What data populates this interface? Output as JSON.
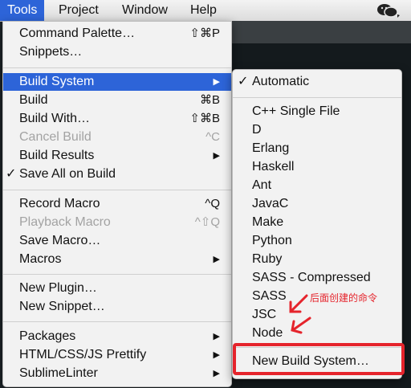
{
  "menubar": {
    "items": [
      "Tools",
      "Project",
      "Window",
      "Help"
    ],
    "active": "Tools"
  },
  "tools_menu": {
    "command_palette": {
      "label": "Command Palette…",
      "shortcut": "⇧⌘P"
    },
    "snippets": {
      "label": "Snippets…"
    },
    "build_system": {
      "label": "Build System"
    },
    "build": {
      "label": "Build",
      "shortcut": "⌘B"
    },
    "build_with": {
      "label": "Build With…",
      "shortcut": "⇧⌘B"
    },
    "cancel_build": {
      "label": "Cancel Build",
      "shortcut": "^C"
    },
    "build_results": {
      "label": "Build Results"
    },
    "save_all_on_build": {
      "label": "Save All on Build",
      "checked": true
    },
    "record_macro": {
      "label": "Record Macro",
      "shortcut": "^Q"
    },
    "playback_macro": {
      "label": "Playback Macro",
      "shortcut": "^⇧Q"
    },
    "save_macro": {
      "label": "Save Macro…"
    },
    "macros": {
      "label": "Macros"
    },
    "new_plugin": {
      "label": "New Plugin…"
    },
    "new_snippet": {
      "label": "New Snippet…"
    },
    "packages": {
      "label": "Packages"
    },
    "html_prettify": {
      "label": "HTML/CSS/JS Prettify"
    },
    "sublime_linter": {
      "label": "SublimeLinter"
    }
  },
  "build_system_menu": {
    "automatic": {
      "label": "Automatic",
      "checked": true
    },
    "items": [
      "C++ Single File",
      "D",
      "Erlang",
      "Haskell",
      "Ant",
      "JavaC",
      "Make",
      "Python",
      "Ruby",
      "SASS - Compressed",
      "SASS",
      "JSC",
      "Node"
    ],
    "new_build_system": {
      "label": "New Build System…"
    }
  },
  "symbols": {
    "check": "✓",
    "submenu_arrow": "▶"
  },
  "annotation": {
    "text": "后面创建的命令",
    "color": "#e5242c"
  },
  "colors": {
    "highlight": "#2d64d8",
    "menu_bg": "#f2f2f2",
    "annotation": "#e5242c"
  }
}
